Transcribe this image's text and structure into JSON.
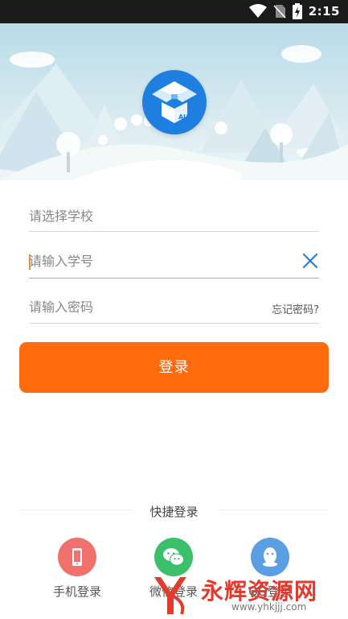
{
  "status_bar": {
    "time": "2:15"
  },
  "form": {
    "school_placeholder": "请选择学校",
    "student_id_placeholder": "请输入学号",
    "password_placeholder": "请输入密码",
    "forgot_password": "忘记密码?",
    "login_label": "登录"
  },
  "quick_login": {
    "title": "快捷登录",
    "items": [
      {
        "label": "手机登录",
        "icon": "phone-icon",
        "color": "#f0706b"
      },
      {
        "label": "微信登录",
        "icon": "wechat-icon",
        "color": "#3bbf6a"
      },
      {
        "label": "QQ登录",
        "icon": "qq-icon",
        "color": "#5a9ee4"
      }
    ]
  },
  "watermark": {
    "text": "永辉资源网",
    "url": "www.yhkjjj.com"
  },
  "colors": {
    "accent": "#ff6b0d",
    "clear_icon": "#2a7fd4",
    "logo": "#1f7fe0"
  }
}
